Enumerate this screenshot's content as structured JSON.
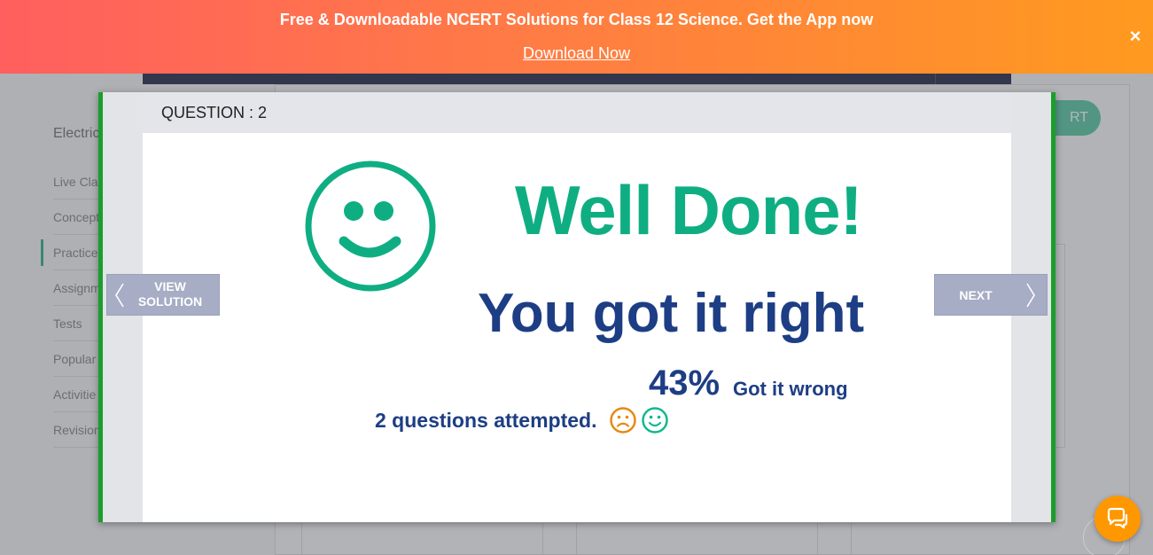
{
  "banner": {
    "message": "Free & Downloadable NCERT Solutions for Class 12 Science. Get the App now",
    "link_label": "Download Now",
    "close_label": "×"
  },
  "background": {
    "sidebar_title": "Electric",
    "sidebar_items": [
      "Live Cla",
      "Concept",
      "Practice",
      "Assignm",
      "Tests",
      "Popular",
      "Activitie",
      "Revision"
    ],
    "start_button": "RT"
  },
  "modal": {
    "question_label": "QUESTION : 2",
    "headline": "Well Done!",
    "subheadline": "You got it right",
    "percent": "43%",
    "percent_label": "Got it wrong",
    "attempted_text": "2 questions attempted.",
    "prev_button_line1": "VIEW",
    "prev_button_line2": "SOLUTION",
    "next_button": "NEXT"
  },
  "colors": {
    "banner_start": "#ff5f5f",
    "banner_end": "#ff9a1f",
    "success_green": "#0fae82",
    "text_navy": "#1d3e84",
    "modal_border": "#1b9e2c",
    "nav_button": "#a6adc4",
    "sad_orange": "#e58a12",
    "chat_orange": "#ff9800"
  },
  "icons": {
    "big": "smiley-face-icon",
    "sad": "sad-face-icon",
    "happy": "happy-face-icon",
    "prev": "chevron-left-icon",
    "next": "chevron-right-icon",
    "chat": "chat-bubble-icon",
    "close": "close-icon"
  }
}
